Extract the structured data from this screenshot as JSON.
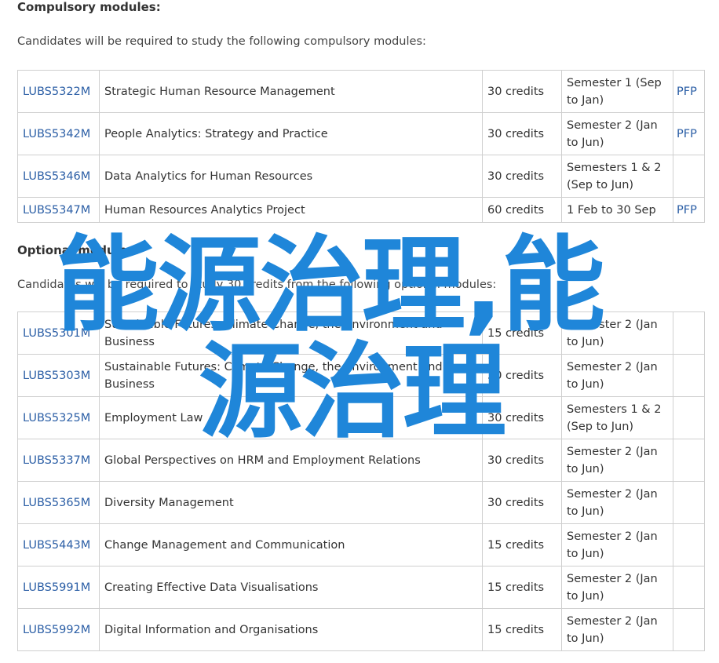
{
  "compulsory": {
    "heading": "Compulsory modules:",
    "intro": "Candidates will be required to study the following compulsory modules:",
    "rows": [
      {
        "code": "LUBS5322M",
        "title": "Strategic Human Resource Management",
        "credits": "30 credits",
        "semester": "Semester 1 (Sep to Jan)",
        "pfp": "PFP"
      },
      {
        "code": "LUBS5342M",
        "title": "People Analytics: Strategy and Practice",
        "credits": "30 credits",
        "semester": "Semester 2 (Jan to Jun)",
        "pfp": "PFP"
      },
      {
        "code": "LUBS5346M",
        "title": "Data Analytics for Human Resources",
        "credits": "30 credits",
        "semester": "Semesters 1 & 2 (Sep to Jun)",
        "pfp": ""
      },
      {
        "code": "LUBS5347M",
        "title": "Human Resources Analytics Project",
        "credits": "60 credits",
        "semester": "1 Feb to 30 Sep",
        "pfp": "PFP"
      }
    ]
  },
  "optional": {
    "heading": "Optional modules:",
    "intro": "Candidates will be required to study 30 credits from the following optional modules:",
    "rows": [
      {
        "code": "LUBS5301M",
        "title": "Sustainable Futures: Climate Change, the Environment and Business",
        "credits": "15 credits",
        "semester": "Semester 2 (Jan to Jun)",
        "pfp": ""
      },
      {
        "code": "LUBS5303M",
        "title": "Sustainable Futures: Climate Change, the Environment and Business",
        "credits": "30 credits",
        "semester": "Semester 2 (Jan to Jun)",
        "pfp": ""
      },
      {
        "code": "LUBS5325M",
        "title": "Employment Law",
        "credits": "30 credits",
        "semester": "Semesters 1 & 2 (Sep to Jun)",
        "pfp": ""
      },
      {
        "code": "LUBS5337M",
        "title": "Global Perspectives on HRM and Employment Relations",
        "credits": "30 credits",
        "semester": "Semester 2 (Jan to Jun)",
        "pfp": ""
      },
      {
        "code": "LUBS5365M",
        "title": "Diversity Management",
        "credits": "30 credits",
        "semester": "Semester 2 (Jan to Jun)",
        "pfp": ""
      },
      {
        "code": "LUBS5443M",
        "title": "Change Management and Communication",
        "credits": "15 credits",
        "semester": "Semester 2 (Jan to Jun)",
        "pfp": ""
      },
      {
        "code": "LUBS5991M",
        "title": "Creating Effective Data Visualisations",
        "credits": "15 credits",
        "semester": "Semester 2 (Jan to Jun)",
        "pfp": ""
      },
      {
        "code": "LUBS5992M",
        "title": "Digital Information and Organisations",
        "credits": "15 credits",
        "semester": "Semester 2 (Jan to Jun)",
        "pfp": ""
      }
    ]
  },
  "watermark": {
    "line1": "能源治理,能",
    "line2": "源治理",
    "color": "#1f86d9"
  },
  "colors": {
    "link": "#2c5fa6",
    "border": "#cfcfcf"
  }
}
